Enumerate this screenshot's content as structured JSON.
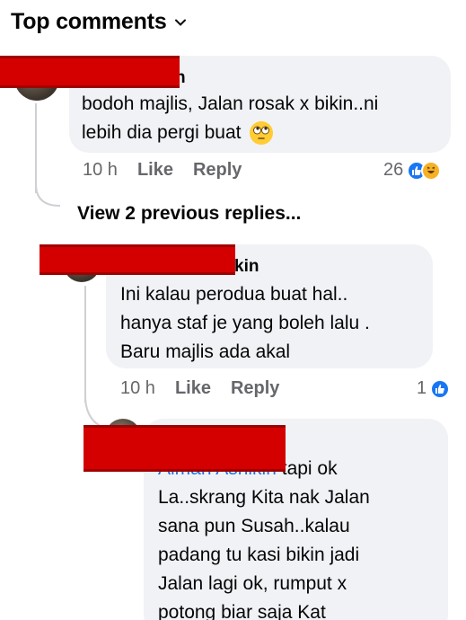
{
  "header": {
    "title": "Top comments"
  },
  "comments": [
    {
      "name": "n",
      "lines": [
        "bodoh majlis, Jalan rosak x bikin..ni",
        "lebih dia pergi buat"
      ],
      "emoji": "rolling-eyes",
      "time": "10 h",
      "like": "Like",
      "reply": "Reply",
      "reaction_count": "26"
    }
  ],
  "view_previous": "View 2 previous replies...",
  "replies": [
    {
      "name": "kin",
      "lines": [
        "Ini kalau perodua buat hal..",
        "hanya staf je yang boleh lalu .",
        "Baru majlis ada akal"
      ],
      "time": "10 h",
      "like": "Like",
      "reply": "Reply",
      "reaction_count": "1"
    },
    {
      "mention": "Aiman Ashikin",
      "lines_after_mention": " tapi ok",
      "lines": [
        "La..skrang Kita nak Jalan",
        "sana pun Susah..kalau",
        "padang tu kasi bikin jadi",
        "Jalan lagi ok, rumput x",
        "potong biar saja Kat"
      ]
    }
  ],
  "colors": {
    "bubble": "#f0f2f5",
    "meta": "#65676b",
    "link": "#216fdb",
    "redact": "#d40000"
  }
}
